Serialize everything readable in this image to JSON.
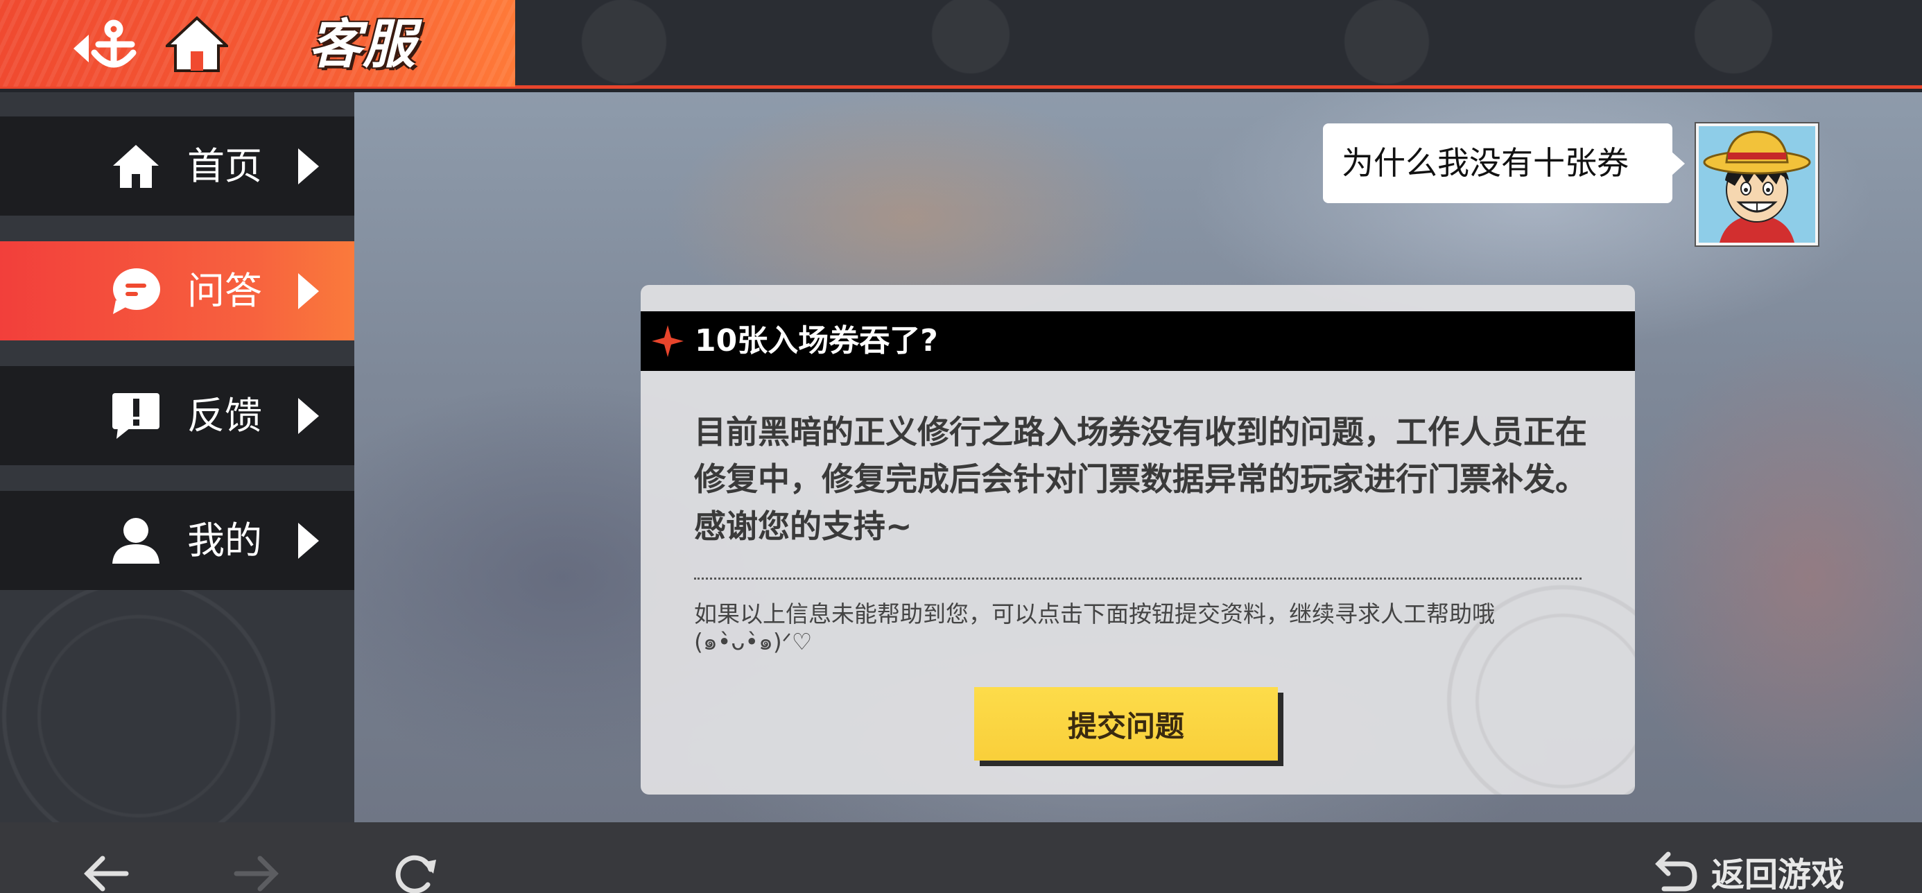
{
  "header": {
    "title": "客服",
    "back_icon": "anchor-back-icon",
    "home_icon": "home-icon",
    "accent_color": "#f04a30"
  },
  "sidebar": {
    "items": [
      {
        "label": "首页",
        "icon": "home-icon",
        "active": false
      },
      {
        "label": "问答",
        "icon": "chat-bubble-icon",
        "active": true
      },
      {
        "label": "反馈",
        "icon": "feedback-exclamation-icon",
        "active": false
      },
      {
        "label": "我的",
        "icon": "user-icon",
        "active": false
      }
    ]
  },
  "chat": {
    "question": "为什么我没有十张券"
  },
  "answer_card": {
    "title": "10张入场券吞了?",
    "body": "目前黑暗的正义修行之路入场券没有收到的问题，工作人员正在修复中，修复完成后会针对门票数据异常的玩家进行门票补发。感谢您的支持~",
    "hint": "如果以上信息未能帮助到您，可以点击下面按钮提交资料，继续寻求人工帮助哦(๑•̀ᴗ•̀๑)ᐟ♡",
    "submit_label": "提交问题",
    "submit_color": "#fddc4a"
  },
  "bottom_bar": {
    "return_label": "返回游戏"
  }
}
